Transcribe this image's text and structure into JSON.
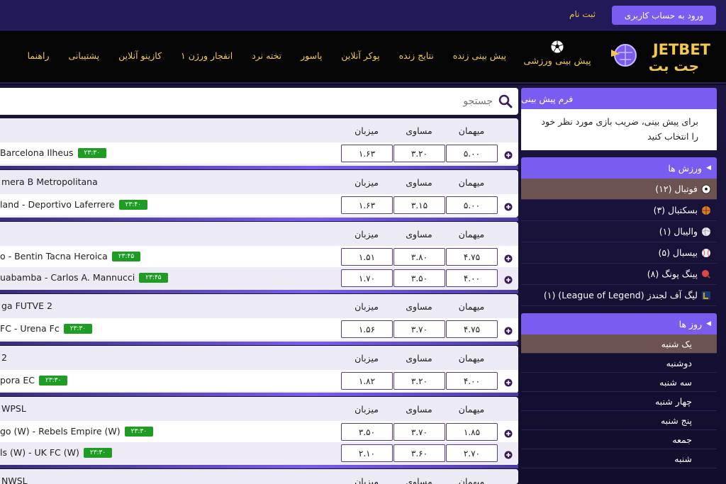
{
  "topbar": {
    "login_label": "ورود به حساب کاربری",
    "register_label": "ثبت نام"
  },
  "logo": {
    "en": "JETBET",
    "fa": "جت بت"
  },
  "nav": {
    "sports_label": "پیش بینی ورزشی",
    "items": [
      "پیش بینی زنده",
      "نتایج زنده",
      "پوکر آنلاین",
      "پاسور",
      "تخته نرد",
      "انفجار ورژن ۱",
      "کازینو آنلاین",
      "پشتیبانی",
      "راهنما"
    ]
  },
  "search": {
    "placeholder": "جستجو"
  },
  "columns": {
    "away": "میهمان",
    "draw": "مساوی",
    "home": "میزبان"
  },
  "sidebar": {
    "bet_form_title": "فرم پیش بینی",
    "bet_form_text": "برای پیش بینی، ضریب بازی مورد نظر خود را انتخاب کنید",
    "sports_title": "ورزش ها",
    "sports": [
      {
        "label": "فوتبال (۱۲)",
        "icon": "soccer-ball-icon",
        "color": "#ffffff"
      },
      {
        "label": "بسکتبال (۳)",
        "icon": "basketball-icon",
        "color": "#e07a2b"
      },
      {
        "label": "والیبال (۱)",
        "icon": "volleyball-icon",
        "color": "#dddddd"
      },
      {
        "label": "بیسبال (۵)",
        "icon": "baseball-icon",
        "color": "#dddddd"
      },
      {
        "label": "پینگ پونگ (۸)",
        "icon": "ping-pong-icon",
        "color": "#e0454a"
      },
      {
        "label": "لیگ آف لجندز (League of Legend) (۱)",
        "icon": "league-of-legends-icon",
        "color": "#c9a227"
      }
    ],
    "days_title": "روز ها",
    "days": [
      "یک شنبه",
      "دوشنبه",
      "سه شنبه",
      "چهار شنبه",
      "پنج شنبه",
      "جمعه",
      "شنبه"
    ]
  },
  "leagues": [
    {
      "name": "",
      "matches": [
        {
          "teams": "Barcelona Ilheus",
          "time": "۲۳:۳۰",
          "home": "۱.۶۳",
          "draw": "۳.۲۰",
          "away": "۵.۰۰"
        }
      ]
    },
    {
      "name": "mera B Metropolitana",
      "matches": [
        {
          "teams": "land  -  Deportivo Laferrere",
          "time": "۲۳:۴۰",
          "home": "۱.۶۳",
          "draw": "۳.۱۵",
          "away": "۵.۰۰"
        }
      ]
    },
    {
      "name": "",
      "matches": [
        {
          "teams": "o  -  Bentin Tacna Heroica",
          "time": "۲۳:۴۵",
          "home": "۱.۵۱",
          "draw": "۳.۸۰",
          "away": "۴.۷۵"
        },
        {
          "teams": "uabamba  -  Carlos A. Mannucci",
          "time": "۲۳:۴۵",
          "home": "۱.۷۰",
          "draw": "۳.۵۰",
          "away": "۴.۰۰"
        }
      ]
    },
    {
      "name": "ga FUTVE 2",
      "matches": [
        {
          "teams": " FC  -  Urena Fc",
          "time": "۲۳:۳۰",
          "home": "۱.۵۶",
          "draw": "۳.۷۰",
          "away": "۴.۷۵"
        }
      ]
    },
    {
      "name": " 2",
      "matches": [
        {
          "teams": "pora EC",
          "time": "۲۳:۳۰",
          "home": "۱.۸۲",
          "draw": "۳.۲۰",
          "away": "۴.۰۰"
        }
      ]
    },
    {
      "name": " WPSL",
      "matches": [
        {
          "teams": "go (W)  -  Rebels Empire (W)",
          "time": "۲۳:۳۰",
          "home": "۳.۵۰",
          "draw": "۳.۷۰",
          "away": "۱.۸۵"
        },
        {
          "teams": "ls (W)  -  UK FC (W)",
          "time": "۲۳:۳۰",
          "home": "۲.۱۰",
          "draw": "۳.۶۰",
          "away": "۲.۷۰"
        }
      ]
    },
    {
      "name": "NWSL",
      "matches": []
    }
  ]
}
